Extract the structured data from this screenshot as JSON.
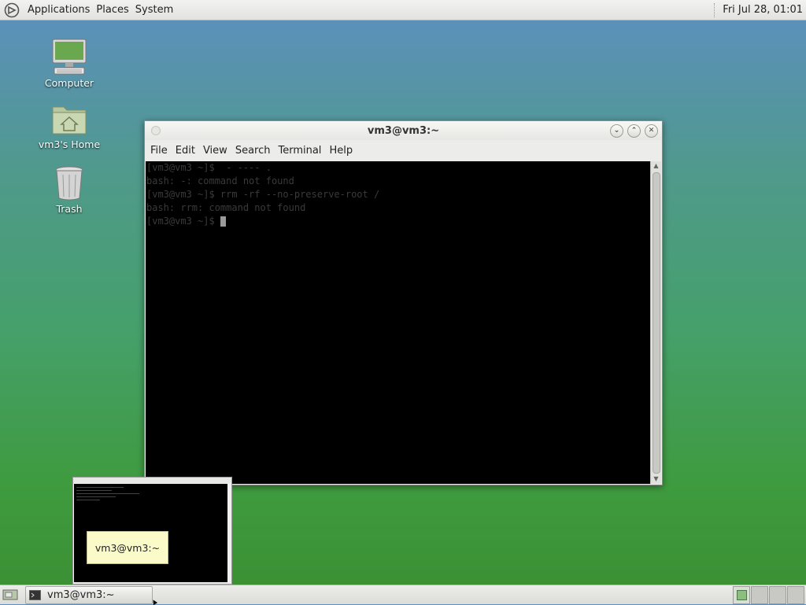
{
  "top_panel": {
    "menus": [
      "Applications",
      "Places",
      "System"
    ],
    "clock": "Fri Jul 28, 01:01"
  },
  "desktop_icons": [
    {
      "label": "Computer",
      "icon": "computer-icon"
    },
    {
      "label": "vm3's Home",
      "icon": "home-folder-icon"
    },
    {
      "label": "Trash",
      "icon": "trash-icon"
    }
  ],
  "terminal_window": {
    "title": "vm3@vm3:~",
    "menus": [
      "File",
      "Edit",
      "View",
      "Search",
      "Terminal",
      "Help"
    ],
    "lines": [
      "[vm3@vm3 ~]$  - ---- .",
      "bash: -: command not found",
      "[vm3@vm3 ~]$ rrm -rf --no-preserve-root /",
      "bash: rrm: command not found",
      "[vm3@vm3 ~]$ "
    ]
  },
  "window_preview": {
    "tooltip": "vm3@vm3:~"
  },
  "taskbar": {
    "task_label": "vm3@vm3:~",
    "workspace_count": 4,
    "active_workspace": 1
  },
  "colors": {
    "desktop_top": "#5d8fc0",
    "desktop_bottom": "#3a8f32",
    "terminal_bg": "#000000",
    "tooltip_bg": "#fbfbc9"
  }
}
